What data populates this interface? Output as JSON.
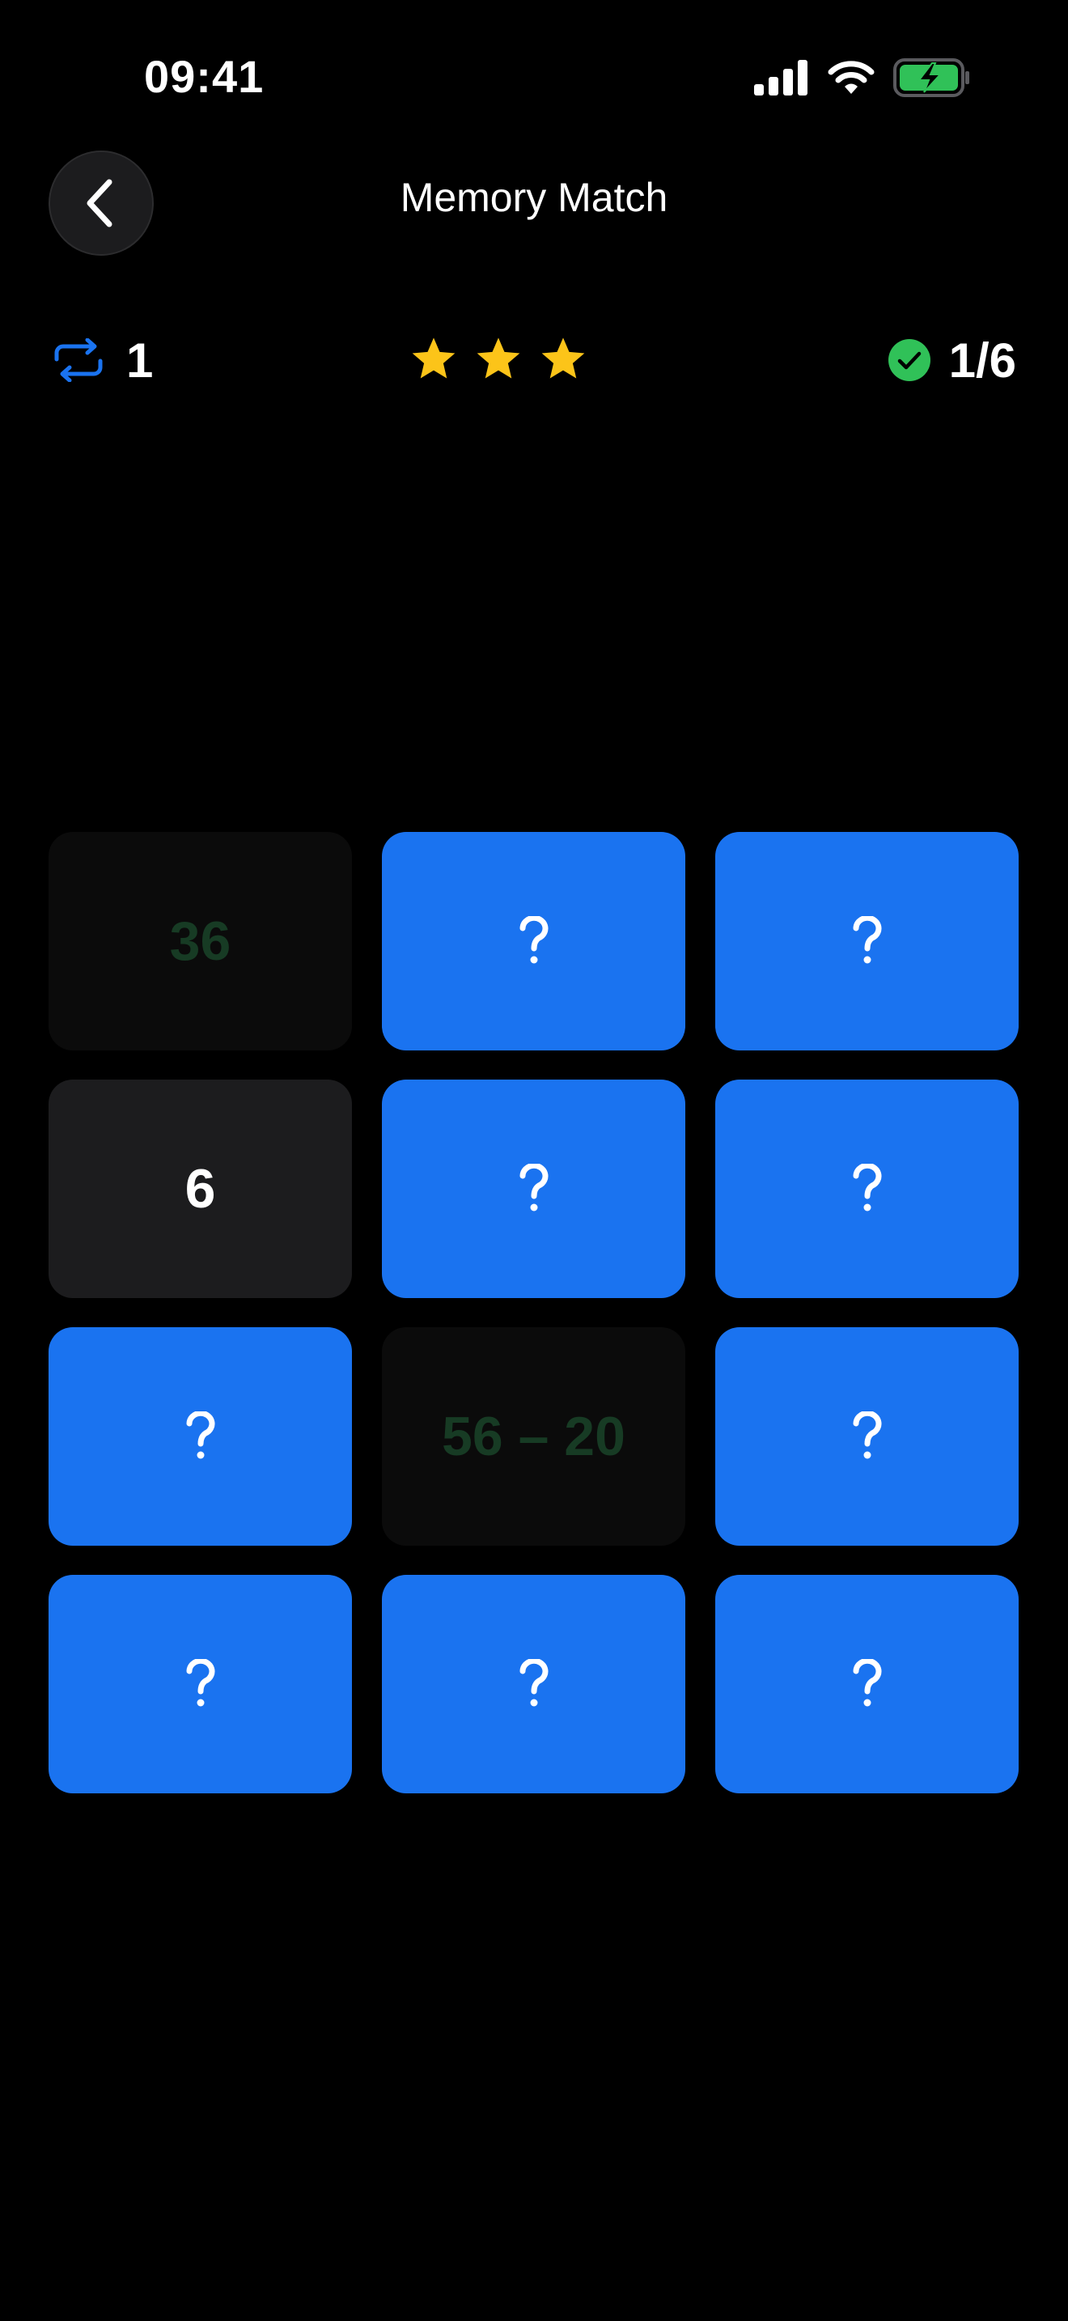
{
  "status_bar": {
    "time": "09:41",
    "icons": [
      "cellular-signal-icon",
      "wifi-icon",
      "battery-charging-icon"
    ]
  },
  "header": {
    "title": "Memory Match",
    "back_icon": "chevron-left-icon"
  },
  "stats": {
    "moves_icon": "repeat-icon",
    "moves": "1",
    "stars_earned": 3,
    "stars_total": 3,
    "progress_icon": "check-circle-icon",
    "progress": "1/6"
  },
  "colors": {
    "accent_blue": "#1a73f0",
    "star_yellow": "#fcc419",
    "success_green": "#30c158",
    "matched_text": "#173b24",
    "card_revealed_bg": "#1c1c1e",
    "card_matched_bg": "#0b0b0b"
  },
  "grid": {
    "columns": 3,
    "cards": [
      {
        "state": "matched",
        "text": "36"
      },
      {
        "state": "hidden",
        "text": "?"
      },
      {
        "state": "hidden",
        "text": "?"
      },
      {
        "state": "revealed",
        "text": "6"
      },
      {
        "state": "hidden",
        "text": "?"
      },
      {
        "state": "hidden",
        "text": "?"
      },
      {
        "state": "hidden",
        "text": "?"
      },
      {
        "state": "matched",
        "text": "56 – 20"
      },
      {
        "state": "hidden",
        "text": "?"
      },
      {
        "state": "hidden",
        "text": "?"
      },
      {
        "state": "hidden",
        "text": "?"
      },
      {
        "state": "hidden",
        "text": "?"
      }
    ]
  }
}
